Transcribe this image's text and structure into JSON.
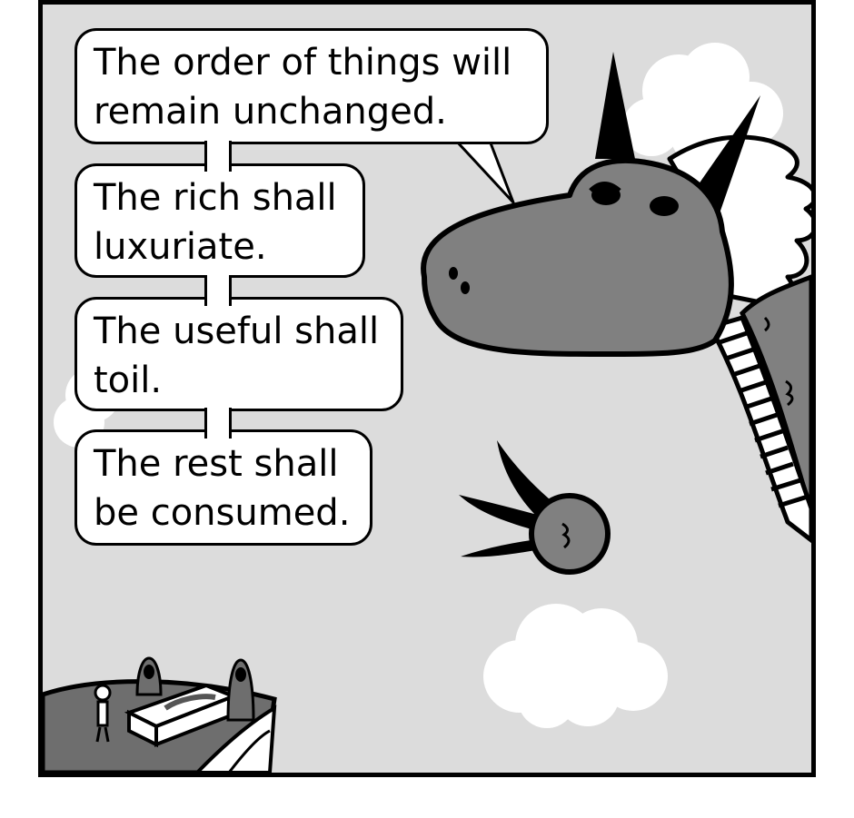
{
  "comic": {
    "bubbles": [
      {
        "line1": "The order of things will",
        "line2": "remain unchanged."
      },
      {
        "line1": "The rich shall",
        "line2": "luxuriate."
      },
      {
        "line1": "The useful shall",
        "line2": "toil."
      },
      {
        "line1": "The rest shall",
        "line2": "be consumed."
      }
    ]
  },
  "colors": {
    "sky": "#dcdcdc",
    "dragon": "#808080",
    "ink": "#000000",
    "cloud": "#ffffff",
    "cliff": "#6e6e6e"
  }
}
